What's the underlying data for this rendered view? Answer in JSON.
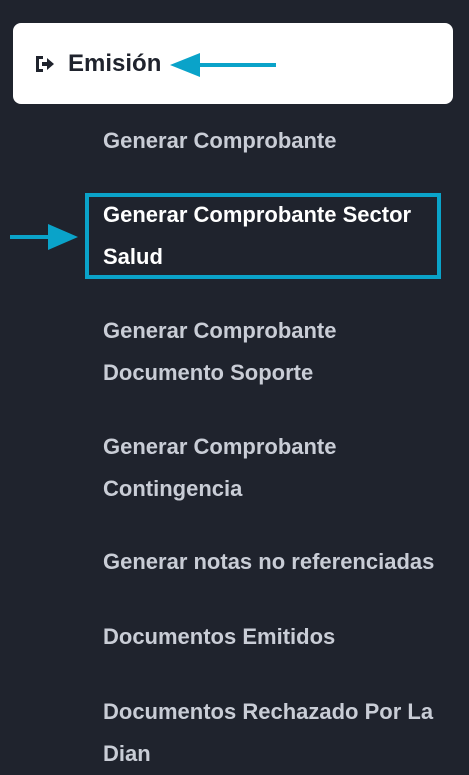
{
  "header": {
    "icon": "sign-out-icon",
    "label": "Emisión"
  },
  "menu": {
    "items": [
      {
        "label": "Generar Comprobante",
        "active": false
      },
      {
        "label": "Generar Comprobante Sector Salud",
        "active": true
      },
      {
        "label": "Generar Comprobante Documento Soporte",
        "active": false
      },
      {
        "label": "Generar Comprobante Contingencia",
        "active": false
      },
      {
        "label": "Generar notas no referenciadas",
        "active": false
      },
      {
        "label": "Documentos Emitidos",
        "active": false
      },
      {
        "label": "Documentos Rechazado Por La Dian",
        "active": false
      }
    ]
  },
  "colors": {
    "background": "#1f232d",
    "header_bg": "#ffffff",
    "item_text": "#c9cdd6",
    "active_text": "#ffffff",
    "annotation": "#0aa3c9"
  }
}
